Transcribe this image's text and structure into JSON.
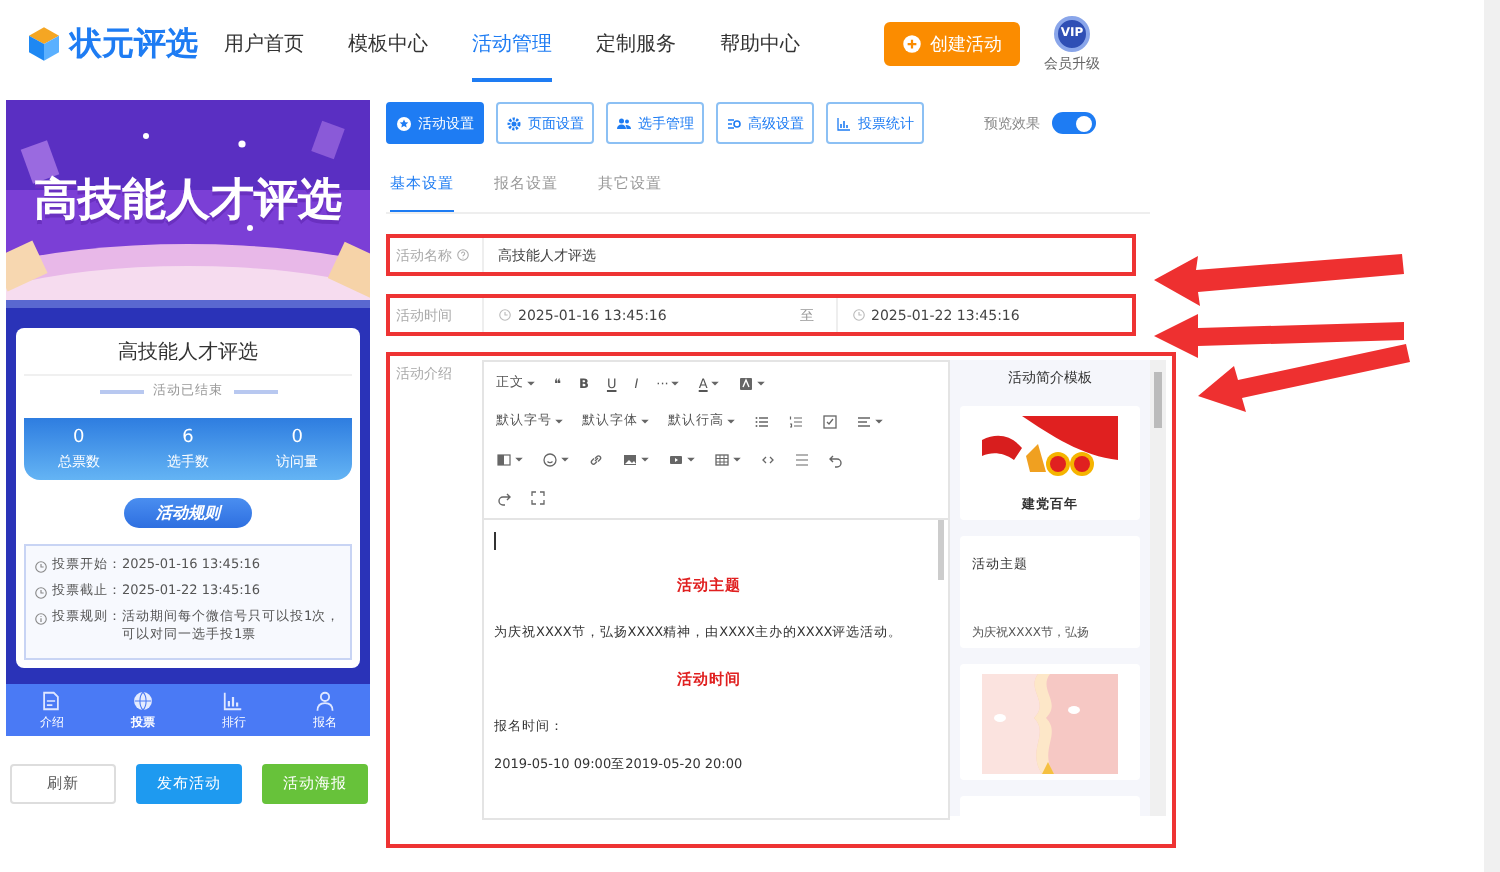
{
  "header": {
    "logo": "状元评选",
    "nav": [
      {
        "label": "用户首页",
        "selected": false
      },
      {
        "label": "模板中心",
        "selected": false
      },
      {
        "label": "活动管理",
        "selected": true
      },
      {
        "label": "定制服务",
        "selected": false
      },
      {
        "label": "帮助中心",
        "selected": false
      }
    ],
    "create_button": "创建活动",
    "vip": {
      "badge": "VIP",
      "label": "会员升级"
    }
  },
  "preview": {
    "banner_title": "高技能人才评选",
    "card_title": "高技能人才评选",
    "status": "活动已结束",
    "stats": [
      {
        "value": "0",
        "label": "总票数"
      },
      {
        "value": "6",
        "label": "选手数"
      },
      {
        "value": "0",
        "label": "访问量"
      }
    ],
    "rules_button": "活动规则",
    "rules": [
      {
        "label": "投票开始：",
        "value": "2025-01-16 13:45:16"
      },
      {
        "label": "投票截止：",
        "value": "2025-01-22 13:45:16"
      },
      {
        "label": "投票规则：",
        "value": "活动期间每个微信号只可以投1次，可以对同一选手投1票"
      }
    ],
    "nav": [
      {
        "label": "介绍",
        "selected": false
      },
      {
        "label": "投票",
        "selected": true
      },
      {
        "label": "排行",
        "selected": false
      },
      {
        "label": "报名",
        "selected": false
      }
    ],
    "buttons": [
      {
        "label": "刷新",
        "kind": "plain"
      },
      {
        "label": "发布活动",
        "kind": "primary"
      },
      {
        "label": "活动海报",
        "kind": "success"
      }
    ]
  },
  "toolbar": {
    "buttons": [
      {
        "label": "活动设置",
        "selected": true
      },
      {
        "label": "页面设置",
        "selected": false
      },
      {
        "label": "选手管理",
        "selected": false
      },
      {
        "label": "高级设置",
        "selected": false
      },
      {
        "label": "投票统计",
        "selected": false
      }
    ],
    "preview_toggle": {
      "label": "预览效果",
      "on": true
    }
  },
  "tabs": [
    {
      "label": "基本设置",
      "selected": true
    },
    {
      "label": "报名设置",
      "selected": false
    },
    {
      "label": "其它设置",
      "selected": false
    }
  ],
  "form": {
    "name": {
      "label": "活动名称",
      "value": "高技能人才评选"
    },
    "time": {
      "label": "活动时间",
      "start": "2025-01-16 13:45:16",
      "separator": "至",
      "end": "2025-01-22 13:45:16"
    },
    "intro": {
      "label": "活动介绍",
      "toolbar_rows": [
        [
          {
            "kind": "text",
            "label": "正文",
            "dropdown": true
          },
          {
            "kind": "text",
            "label": "❝",
            "dropdown": false
          },
          {
            "kind": "bold",
            "label": "B",
            "dropdown": false
          },
          {
            "kind": "underline",
            "label": "U",
            "dropdown": false
          },
          {
            "kind": "italic",
            "label": "I",
            "dropdown": false
          },
          {
            "kind": "text",
            "label": "···",
            "dropdown": true
          },
          {
            "kind": "underline",
            "label": "A",
            "dropdown": true
          },
          {
            "kind": "icon",
            "dropdown": true
          }
        ],
        [
          {
            "kind": "text",
            "label": "默认字号",
            "dropdown": true
          },
          {
            "kind": "text",
            "label": "默认字体",
            "dropdown": true
          },
          {
            "kind": "text",
            "label": "默认行高",
            "dropdown": true
          },
          {
            "kind": "icon",
            "dropdown": false
          },
          {
            "kind": "icon",
            "dropdown": false
          },
          {
            "kind": "icon",
            "dropdown": false
          },
          {
            "kind": "icon",
            "dropdown": true
          }
        ],
        [
          {
            "kind": "icon",
            "dropdown": true
          },
          {
            "kind": "icon",
            "dropdown": true
          },
          {
            "kind": "icon",
            "dropdown": false
          },
          {
            "kind": "icon",
            "dropdown": true
          },
          {
            "kind": "icon",
            "dropdown": true
          },
          {
            "kind": "icon",
            "dropdown": true
          },
          {
            "kind": "icon",
            "dropdown": false
          },
          {
            "kind": "icon",
            "dropdown": false
          },
          {
            "kind": "icon",
            "dropdown": false
          }
        ],
        [
          {
            "kind": "icon",
            "dropdown": false
          },
          {
            "kind": "icon",
            "dropdown": false
          }
        ]
      ],
      "content": [
        {
          "kind": "heading",
          "text": "活动主题"
        },
        {
          "kind": "paragraph",
          "text": "为庆祝XXXX节，弘扬XXXX精神，由XXXX主办的XXXX评选活动。"
        },
        {
          "kind": "heading",
          "text": "活动时间"
        },
        {
          "kind": "paragraph",
          "text": "报名时间："
        },
        {
          "kind": "paragraph",
          "text": "2019-05-10 09:00至2019-05-20 20:00"
        }
      ],
      "templates": {
        "title": "活动简介模板",
        "cards": [
          {
            "kind": "picture",
            "caption": "建党百年"
          },
          {
            "kind": "text",
            "title": "活动主题",
            "text": "为庆祝XXXX节，弘扬"
          },
          {
            "kind": "picture"
          },
          {
            "kind": "empty"
          }
        ]
      }
    }
  }
}
